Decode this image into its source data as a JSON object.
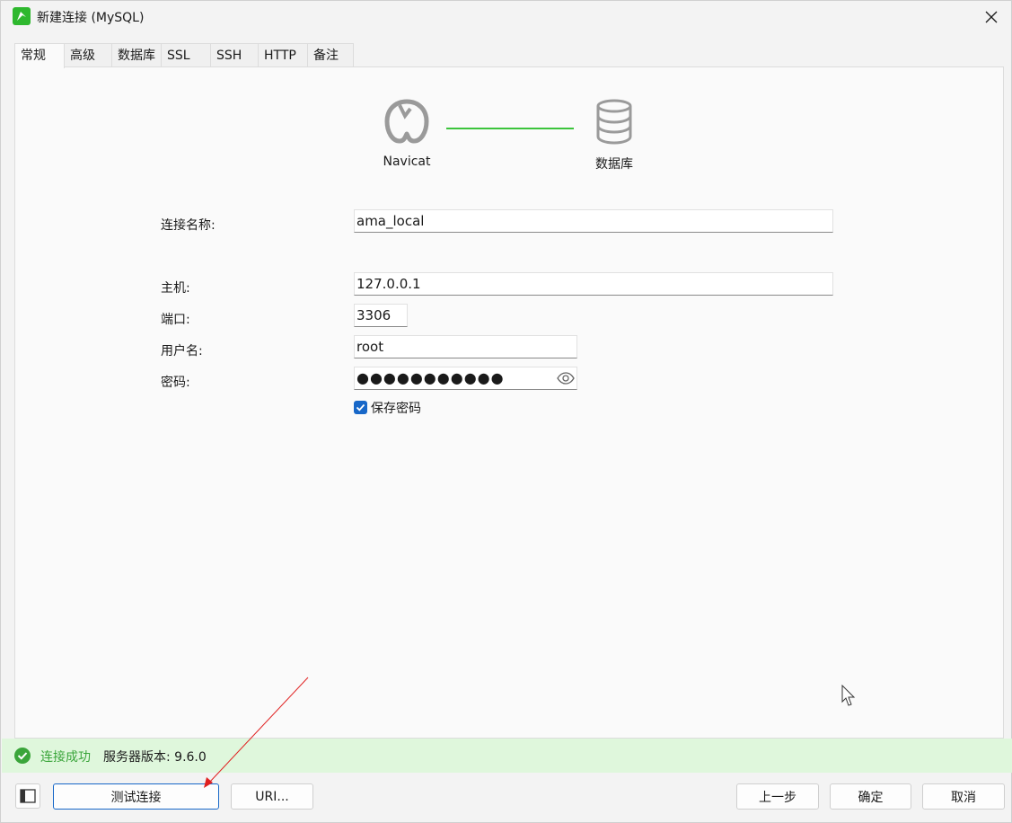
{
  "window": {
    "title": "新建连接 (MySQL)"
  },
  "tabs": [
    {
      "label": "常规",
      "active": true
    },
    {
      "label": "高级"
    },
    {
      "label": "数据库"
    },
    {
      "label": "SSL"
    },
    {
      "label": "SSH"
    },
    {
      "label": "HTTP"
    },
    {
      "label": "备注"
    }
  ],
  "diagram": {
    "left_label": "Navicat",
    "right_label": "数据库",
    "line_color": "#3cc43c"
  },
  "form": {
    "connection_name_label": "连接名称:",
    "connection_name_value": "ama_local",
    "host_label": "主机:",
    "host_value": "127.0.0.1",
    "port_label": "端口:",
    "port_value": "3306",
    "username_label": "用户名:",
    "username_value": "root",
    "password_label": "密码:",
    "password_value": "●●●●●●●●●●●",
    "save_password_label": "保存密码",
    "save_password_checked": true
  },
  "status": {
    "message": "连接成功",
    "server_version": "服务器版本: 9.6.0",
    "color": "#3aa53a"
  },
  "buttons": {
    "test_connection": "测试连接",
    "uri": "URI...",
    "previous": "上一步",
    "ok": "确定",
    "cancel": "取消"
  },
  "colors": {
    "accent": "#1767c8",
    "success_bg": "#dff7dc",
    "annotation_arrow": "#e02020"
  }
}
